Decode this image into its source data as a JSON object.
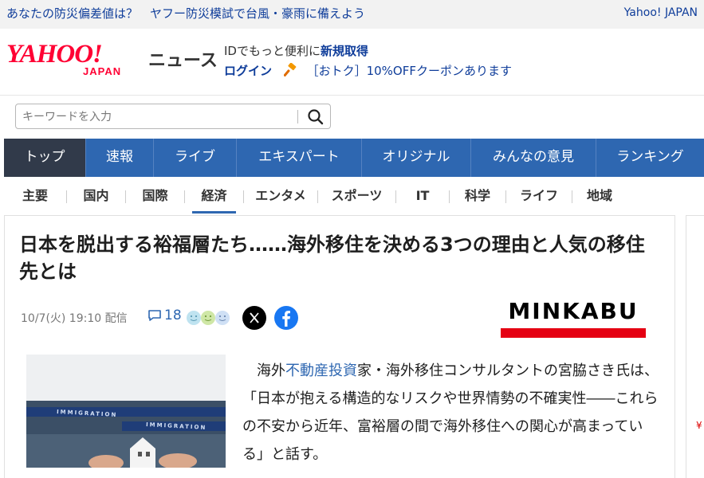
{
  "topbar": {
    "promo": "あなたの防災偏差値は？　ヤフー防災模試で台風・豪雨に備えよう",
    "yahoo_japan_link": "Yahoo! JAPAN"
  },
  "header": {
    "logo_text": "YAHOO!",
    "logo_sub": "JAPAN",
    "service_name": "ニュース",
    "id_prompt": "IDでもっと便利に",
    "register_link": "新規取得",
    "login_link": "ログイン",
    "coupon_text": "［おトク］10%OFFクーポンあります"
  },
  "search": {
    "placeholder": "キーワードを入力"
  },
  "nav_main": {
    "items": [
      {
        "label": "トップ"
      },
      {
        "label": "速報"
      },
      {
        "label": "ライブ"
      },
      {
        "label": "エキスパート"
      },
      {
        "label": "オリジナル"
      },
      {
        "label": "みんなの意見"
      },
      {
        "label": "ランキング"
      }
    ]
  },
  "nav_category": {
    "items": [
      {
        "label": "主要"
      },
      {
        "label": "国内"
      },
      {
        "label": "国際"
      },
      {
        "label": "経済"
      },
      {
        "label": "エンタメ"
      },
      {
        "label": "スポーツ"
      },
      {
        "label": "IT"
      },
      {
        "label": "科学"
      },
      {
        "label": "ライフ"
      },
      {
        "label": "地域"
      }
    ]
  },
  "article": {
    "title": "日本を脱出する裕福層たち……海外移住を決める3つの理由と人気の移住先とは",
    "datetime": "10/7(火) 19:10 配信",
    "comment_count": "18",
    "publisher": "MINKABU",
    "image_banner_1": "IMMIGRATION",
    "image_banner_2": "IMMIGRATION",
    "body_pre": "海外",
    "body_link": "不動産投資",
    "body_post": "家・海外移住コンサルタントの宮脇さき氏は、「日本が抱える構造的なリスクや世界情勢の不確実性――これらの不安から近年、富裕層の間で海外移住への関心が高まっている」と話す。"
  },
  "sidebar": {
    "yen_mark": "¥"
  },
  "colors": {
    "brand_red": "#ff0033",
    "nav_blue": "#2e67b1",
    "nav_active": "#313a4a",
    "link_blue": "#0f3d9a"
  }
}
